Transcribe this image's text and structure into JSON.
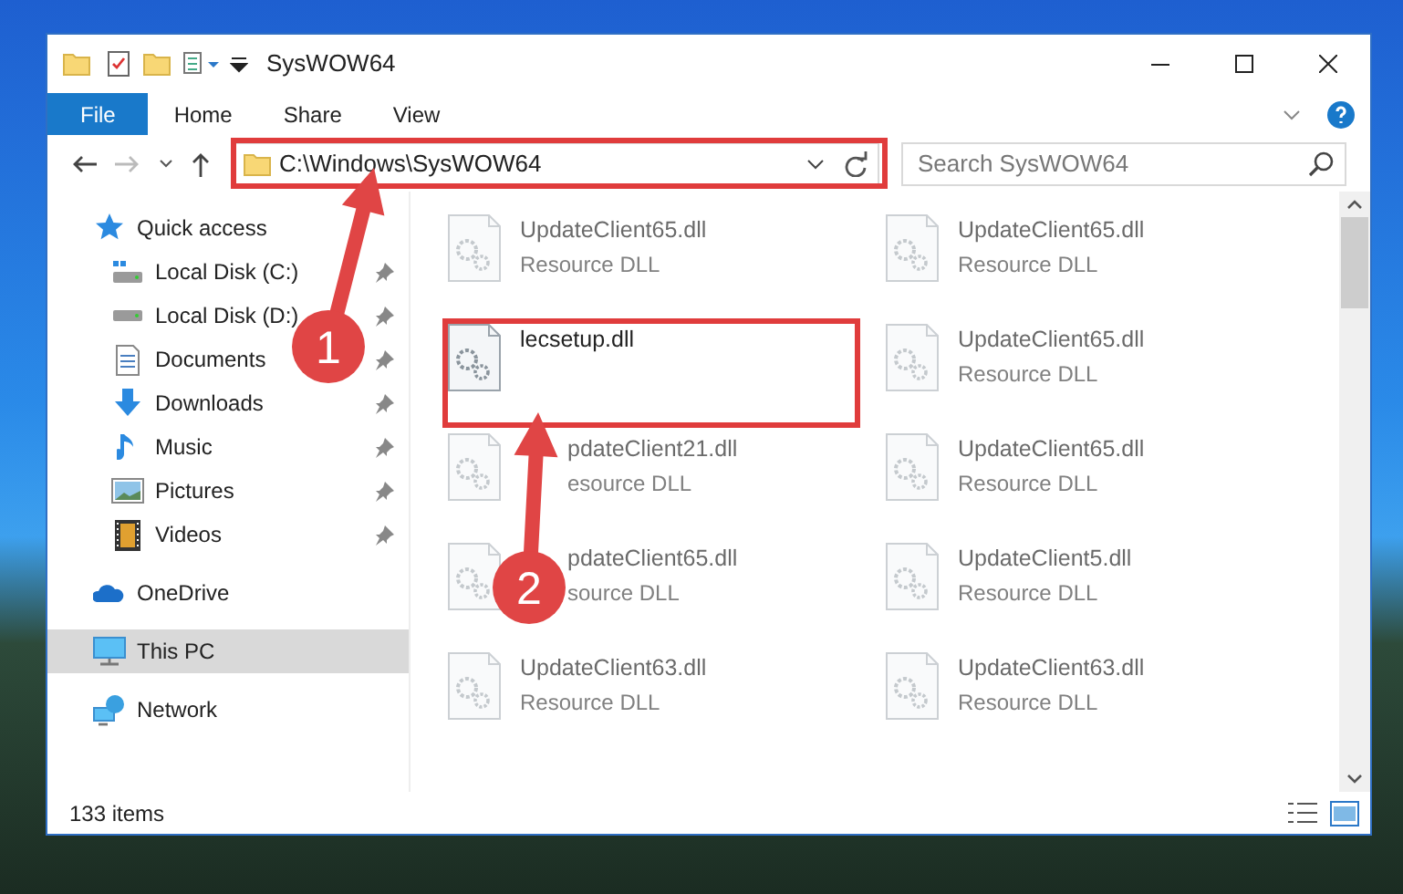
{
  "window": {
    "title": "SysWOW64"
  },
  "ribbon_tabs": [
    {
      "label": "File",
      "kind": "file"
    },
    {
      "label": "Home",
      "kind": "tab"
    },
    {
      "label": "Share",
      "kind": "tab"
    },
    {
      "label": "View",
      "kind": "tab"
    }
  ],
  "address": {
    "path": "C:\\Windows\\SysWOW64"
  },
  "search": {
    "placeholder": "Search SysWOW64"
  },
  "sidebar": {
    "items": [
      {
        "label": "Quick access",
        "selected": false,
        "children": [
          {
            "label": "Local Disk (C:)",
            "pinned": true,
            "selected": false
          },
          {
            "label": "Local Disk (D:)",
            "pinned": true,
            "selected": false
          },
          {
            "label": "Documents",
            "pinned": true,
            "selected": false
          },
          {
            "label": "Downloads",
            "pinned": true,
            "selected": false
          },
          {
            "label": "Music",
            "pinned": true,
            "selected": false
          },
          {
            "label": "Pictures",
            "pinned": true,
            "selected": false
          },
          {
            "label": "Videos",
            "pinned": true,
            "selected": false
          }
        ]
      },
      {
        "label": "OneDrive",
        "selected": false
      },
      {
        "label": "This PC",
        "selected": true
      },
      {
        "label": "Network",
        "selected": false
      }
    ]
  },
  "files": [
    {
      "name": "UpdateClient65.dll",
      "type": "Resource DLL",
      "blurred": true
    },
    {
      "name": "UpdateClient65.dll",
      "type": "Resource DLL",
      "blurred": true
    },
    {
      "name": "lecsetup.dll",
      "blurred": false
    },
    {
      "name": "UpdateClient65.dll",
      "type": "Resource DLL",
      "blurred": true
    },
    {
      "name": "pdateClient21.dll",
      "type": "esource DLL",
      "blurred": true
    },
    {
      "name": "UpdateClient65.dll",
      "type": "Resource DLL",
      "blurred": true
    },
    {
      "name": "pdateClient65.dll",
      "type": "source DLL",
      "blurred": true
    },
    {
      "name": "UpdateClient5.dll",
      "type": "Resource DLL",
      "blurred": true
    },
    {
      "name": "UpdateClient63.dll",
      "type": "Resource DLL",
      "blurred": true
    },
    {
      "name": "UpdateClient63.dll",
      "type": "Resource DLL",
      "blurred": true
    }
  ],
  "status_bar": {
    "count": "133 items"
  },
  "annotations": [
    {
      "kind": "box"
    },
    {
      "kind": "box"
    },
    {
      "kind": "arrow",
      "label": "1"
    },
    {
      "kind": "arrow",
      "label": "2"
    }
  ]
}
